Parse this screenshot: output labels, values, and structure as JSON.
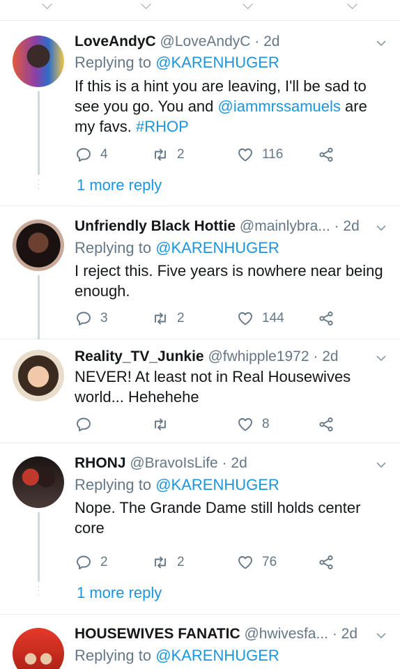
{
  "top_icons": [
    "reply-icon",
    "retweet-icon",
    "like-icon",
    "share-icon"
  ],
  "tweets": [
    {
      "name": "LoveAndyC",
      "handle": "@LoveAndyC",
      "time": "· 2d",
      "replying_label": "Replying to",
      "replying_mention": "@KARENHUGER",
      "body_before": "If this is a hint you are leaving, I'll be sad to see you go. You and ",
      "body_mention": "@iammrssamuels",
      "body_middle": " are my favs. ",
      "body_hashtag": "#RHOP",
      "replies": "4",
      "retweets": "2",
      "likes": "116",
      "more": "1 more reply"
    },
    {
      "name": "Unfriendly Black Hottie",
      "handle": "@mainlybra...",
      "time": "· 2d",
      "replying_label": "Replying to",
      "replying_mention": "@KARENHUGER",
      "body": "I reject this. Five years is nowhere near being enough.",
      "replies": "3",
      "retweets": "2",
      "likes": "144"
    },
    {
      "name": "Reality_TV_Junkie",
      "handle": "@fwhipple1972",
      "time": "· 2d",
      "body": "NEVER! At least not in Real Housewives world... Hehehehe",
      "replies": "",
      "retweets": "",
      "likes": "8"
    },
    {
      "name": "RHONJ",
      "handle": "@BravoIsLife",
      "time": "· 2d",
      "replying_label": "Replying to",
      "replying_mention": "@KARENHUGER",
      "body": "Nope. The Grande Dame still holds center core",
      "replies": "2",
      "retweets": "2",
      "likes": "76",
      "more": "1 more reply"
    },
    {
      "name": "HOUSEWIVES FANATIC",
      "handle": "@hwivesfa...",
      "time": "· 2d",
      "replying_label": "Replying to",
      "replying_mention": "@KARENHUGER"
    }
  ],
  "colors": {
    "link": "#1b95e0",
    "muted": "#657786",
    "divider": "#e6ecf0"
  }
}
